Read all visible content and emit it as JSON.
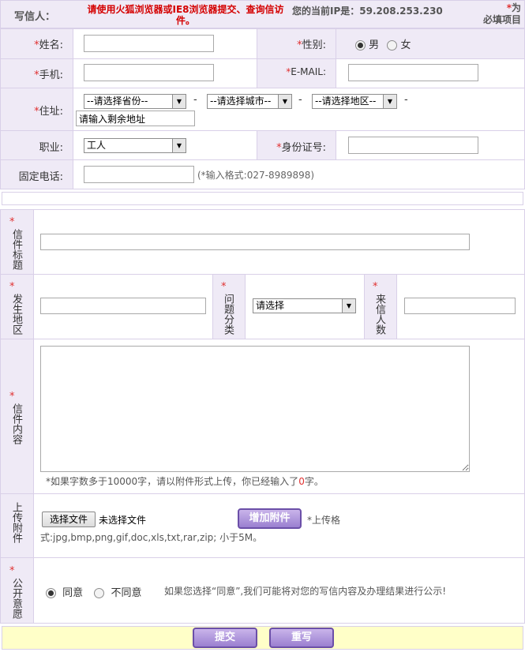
{
  "header": {
    "writer_label": "写信人：",
    "warning": "请使用火狐浏览器或IE8浏览器提交、查询信访件。",
    "ip_text": "您的当前IP是：59.208.253.230",
    "required_star": "*",
    "required_note_1": "为",
    "required_note_2": "必填项目"
  },
  "personal": {
    "name_label": "姓名:",
    "name_value": "",
    "gender_label": "性别:",
    "gender_options": [
      "男",
      "女"
    ],
    "gender_selected": "男",
    "mobile_label": "手机:",
    "mobile_value": "",
    "email_label": "E-MAIL:",
    "email_value": "",
    "address_label": "住址:",
    "province_select": "--请选择省份--",
    "city_select": "--请选择城市--",
    "district_select": "--请选择地区--",
    "dash": "-",
    "address_detail_value": "请输入剩余地址",
    "job_label": "职业:",
    "job_select": "工人",
    "idcard_label": "身份证号:",
    "idcard_value": "",
    "phone_label": "固定电话:",
    "phone_value": "",
    "phone_hint": "(*输入格式:027-8989898)"
  },
  "letter": {
    "title_label": "信件标题",
    "title_value": "",
    "place_label": "发生地区",
    "place_value": "",
    "category_label": "问题分类",
    "category_select": "请选择",
    "people_label": "来信人数",
    "people_value": "",
    "content_label": "信件内容",
    "content_value": "",
    "content_hint_pre": "*如果字数多于10000字，请以附件形式上传，你已经输入了",
    "content_count": "0",
    "content_hint_post": "字。",
    "upload_label": "上传附件",
    "choose_file_label": "选择文件",
    "no_file_text": "未选择文件",
    "add_attachment_label": "增加附件",
    "upload_format_hint": "*上传格",
    "upload_types": "式:jpg,bmp,png,gif,doc,xls,txt,rar,zip; 小于5M。",
    "publish_label": "公开意愿",
    "publish_options": [
      "同意",
      "不同意"
    ],
    "publish_selected": "同意",
    "publish_note": "如果您选择“同意”,我们可能将对您的写信内容及办理结果进行公示!"
  },
  "footer": {
    "submit_label": "提交",
    "reset_label": "重写"
  },
  "colors": {
    "label_bg": "#efeaf6",
    "border": "#d9d0e8",
    "required": "#e03030",
    "warning": "#d40000",
    "footer_bg": "#ffffc8",
    "button": "#9a7fd0"
  }
}
